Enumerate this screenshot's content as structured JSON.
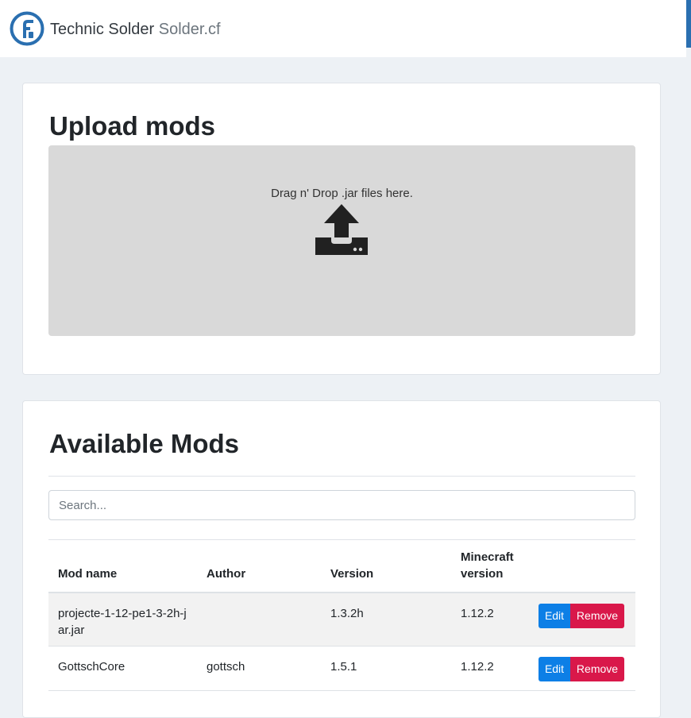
{
  "navbar": {
    "brand": "Technic Solder",
    "brand_sub": "Solder.cf",
    "logo_icon": "solder-logo-icon"
  },
  "upload": {
    "title": "Upload mods",
    "dropzone_text": "Drag n' Drop .jar files here.",
    "icon": "upload-icon"
  },
  "mods": {
    "title": "Available Mods",
    "search": {
      "placeholder": "Search...",
      "value": ""
    },
    "columns": {
      "name": "Mod name",
      "author": "Author",
      "version": "Version",
      "minecraft": "Minecraft version"
    },
    "rows": [
      {
        "name": "projecte-1-12-pe1-3-2h-jar.jar",
        "author": "",
        "version": "1.3.2h",
        "minecraft": "1.12.2",
        "edit": "Edit",
        "remove": "Remove"
      },
      {
        "name": "GottschCore",
        "author": "gottsch",
        "version": "1.5.1",
        "minecraft": "1.12.2",
        "edit": "Edit",
        "remove": "Remove"
      }
    ]
  },
  "colors": {
    "page_bg": "#edf1f5",
    "brand_blue": "#2a6fb0",
    "edit_button": "#0d7fe6",
    "remove_button": "#d9184a",
    "dropzone_bg": "#d9d9d9"
  }
}
